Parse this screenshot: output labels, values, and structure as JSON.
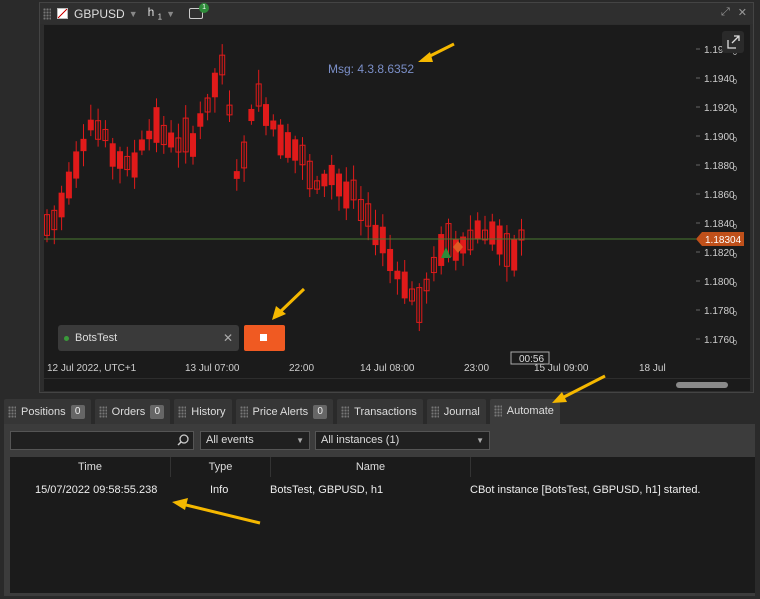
{
  "chart": {
    "symbol": "GBPUSD",
    "timeframe": "h",
    "timeframe_sub": "1",
    "bot_count": "1",
    "message": "Msg: 4.3.8.6352",
    "current_price": "1.18304",
    "price_ticks": [
      "1.1960",
      "1.1940",
      "1.1920",
      "1.1900",
      "1.1880",
      "1.1860",
      "1.1840",
      "1.1820",
      "1.1800",
      "1.1780",
      "1.1760"
    ],
    "price_tick_suffix": "0",
    "time_ticks": [
      "12 Jul 2022, UTC+1",
      "13 Jul 07:00",
      "22:00",
      "14 Jul 08:00",
      "23:00",
      "15 Jul 09:00",
      "18 Jul"
    ],
    "countdown": "00:56",
    "bot_name": "BotsTest",
    "colors": {
      "bear": "#e01b1b",
      "bull": "#e01b1b",
      "price_line": "#4a7a30",
      "price_tag": "#c0501a",
      "stop": "#f05a22",
      "arrow": "#f5b800"
    }
  },
  "tabs": [
    {
      "label": "Positions",
      "badge": "0"
    },
    {
      "label": "Orders",
      "badge": "0"
    },
    {
      "label": "History"
    },
    {
      "label": "Price Alerts",
      "badge": "0"
    },
    {
      "label": "Transactions"
    },
    {
      "label": "Journal"
    },
    {
      "label": "Automate",
      "active": true
    }
  ],
  "automate": {
    "search_placeholder": "",
    "events_filter": "All events",
    "instances_filter": "All instances (1)",
    "columns": [
      "Time",
      "Type",
      "Name",
      ""
    ],
    "rows": [
      {
        "time": "15/07/2022 09:58:55.238",
        "type": "Info",
        "name": "BotsTest, GBPUSD, h1",
        "message": "CBot instance [BotsTest, GBPUSD, h1] started."
      }
    ]
  }
}
